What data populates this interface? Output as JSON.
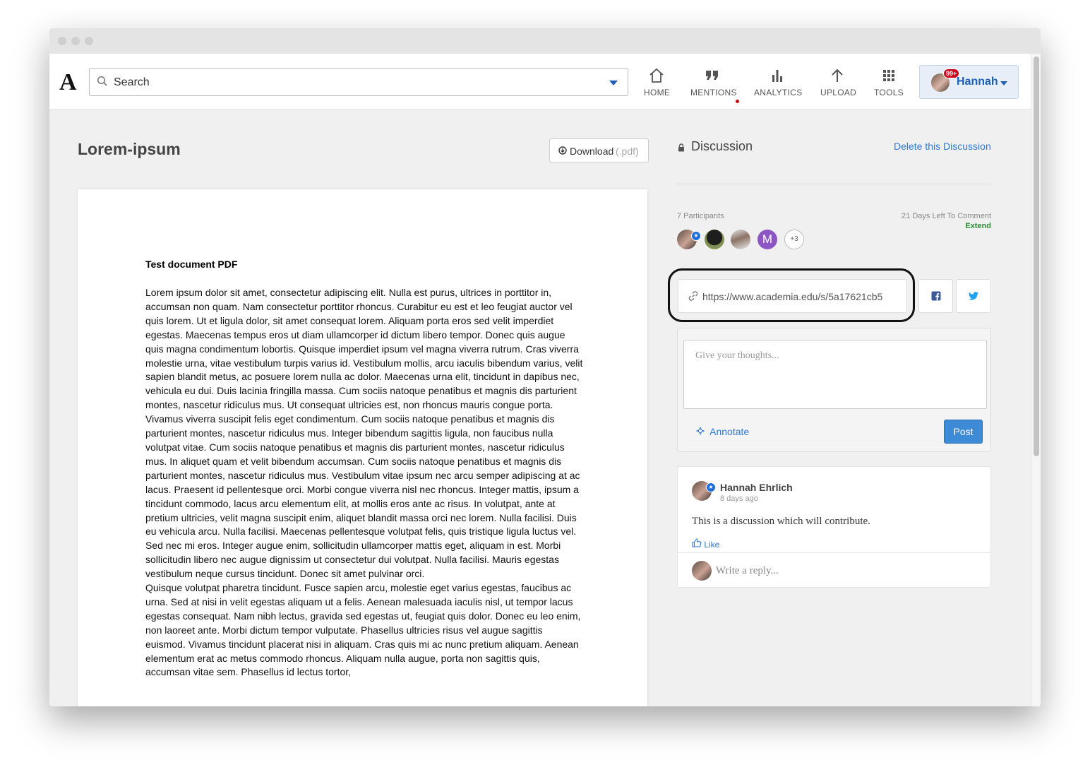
{
  "nav": {
    "search_placeholder": "Search",
    "items": [
      {
        "label": "HOME",
        "icon": "home-icon"
      },
      {
        "label": "MENTIONS",
        "icon": "quote-icon"
      },
      {
        "label": "ANALYTICS",
        "icon": "bar-chart-icon"
      },
      {
        "label": "UPLOAD",
        "icon": "upload-arrow-icon"
      },
      {
        "label": "TOOLS",
        "icon": "grid-icon"
      }
    ],
    "user": {
      "name": "Hannah",
      "badge": "99+"
    }
  },
  "document": {
    "title": "Lorem-ipsum",
    "download_label": "Download",
    "download_ext": "(.pdf)",
    "page_heading": "Test document PDF",
    "paragraph_1": "Lorem ipsum dolor sit amet, consectetur adipiscing elit. Nulla est purus, ultrices in porttitor in, accumsan non quam. Nam consectetur porttitor rhoncus. Curabitur eu est et leo feugiat auctor vel quis lorem. Ut et ligula dolor, sit amet consequat lorem. Aliquam porta eros sed velit imperdiet egestas. Maecenas tempus eros ut diam ullamcorper id dictum libero tempor. Donec quis augue quis magna condimentum lobortis. Quisque imperdiet ipsum vel magna viverra rutrum. Cras viverra molestie urna, vitae vestibulum turpis varius id. Vestibulum mollis, arcu iaculis bibendum varius, velit sapien blandit metus, ac posuere lorem nulla ac dolor. Maecenas urna elit, tincidunt in dapibus nec, vehicula eu dui. Duis lacinia fringilla massa. Cum sociis natoque penatibus et magnis dis parturient montes, nascetur ridiculus mus. Ut consequat ultricies est, non rhoncus mauris congue porta. Vivamus viverra suscipit felis eget condimentum. Cum sociis natoque penatibus et magnis dis parturient montes, nascetur ridiculus mus. Integer bibendum sagittis ligula, non faucibus nulla volutpat vitae. Cum sociis natoque penatibus et magnis dis parturient montes, nascetur ridiculus mus. In aliquet quam et velit bibendum accumsan. Cum sociis natoque penatibus et magnis dis parturient montes, nascetur ridiculus mus. Vestibulum vitae ipsum nec arcu semper adipiscing at ac lacus. Praesent id pellentesque orci. Morbi congue viverra nisl nec rhoncus. Integer mattis, ipsum a tincidunt commodo, lacus arcu elementum elit, at mollis eros ante ac risus. In volutpat, ante at pretium ultricies, velit magna suscipit enim, aliquet blandit massa orci nec lorem. Nulla facilisi. Duis eu vehicula arcu. Nulla facilisi. Maecenas pellentesque volutpat felis, quis tristique ligula luctus vel. Sed nec mi eros. Integer augue enim, sollicitudin ullamcorper mattis eget, aliquam in est. Morbi sollicitudin libero nec augue dignissim ut consectetur dui volutpat. Nulla facilisi. Mauris egestas vestibulum neque cursus tincidunt. Donec sit amet pulvinar orci.",
    "paragraph_2": "Quisque volutpat pharetra tincidunt. Fusce sapien arcu, molestie eget varius egestas, faucibus ac urna. Sed at nisi in velit egestas aliquam ut a felis. Aenean malesuada iaculis nisl, ut tempor lacus egestas consequat. Nam nibh lectus, gravida sed egestas ut, feugiat quis dolor. Donec eu leo enim, non laoreet ante. Morbi dictum tempor vulputate. Phasellus ultricies risus vel augue sagittis euismod. Vivamus tincidunt placerat nisi in aliquam. Cras quis mi ac nunc pretium aliquam. Aenean elementum erat ac metus commodo rhoncus. Aliquam nulla augue, porta non sagittis quis, accumsan vitae sem. Phasellus id lectus tortor,"
  },
  "discussion": {
    "title": "Discussion",
    "delete_label": "Delete this Discussion",
    "participants_label": "7 Participants",
    "days_left": "21 Days Left To Comment",
    "extend_label": "Extend",
    "avatar_initial": "M",
    "more_count": "+3",
    "share_url": "https://www.academia.edu/s/5a17621cb5",
    "comment_placeholder": "Give your thoughts...",
    "annotate_label": "Annotate",
    "post_label": "Post",
    "comment": {
      "author": "Hannah Ehrlich",
      "time": "8 days ago",
      "text": "This is a discussion which will contribute.",
      "like_label": "Like",
      "reply_placeholder": "Write a reply..."
    }
  },
  "colors": {
    "link_blue": "#2f7ad6",
    "post_button": "#3d8bd6",
    "extend_green": "#2e8b3a",
    "notification_red": "#d0021b",
    "avatar_purple": "#8c56c4"
  }
}
